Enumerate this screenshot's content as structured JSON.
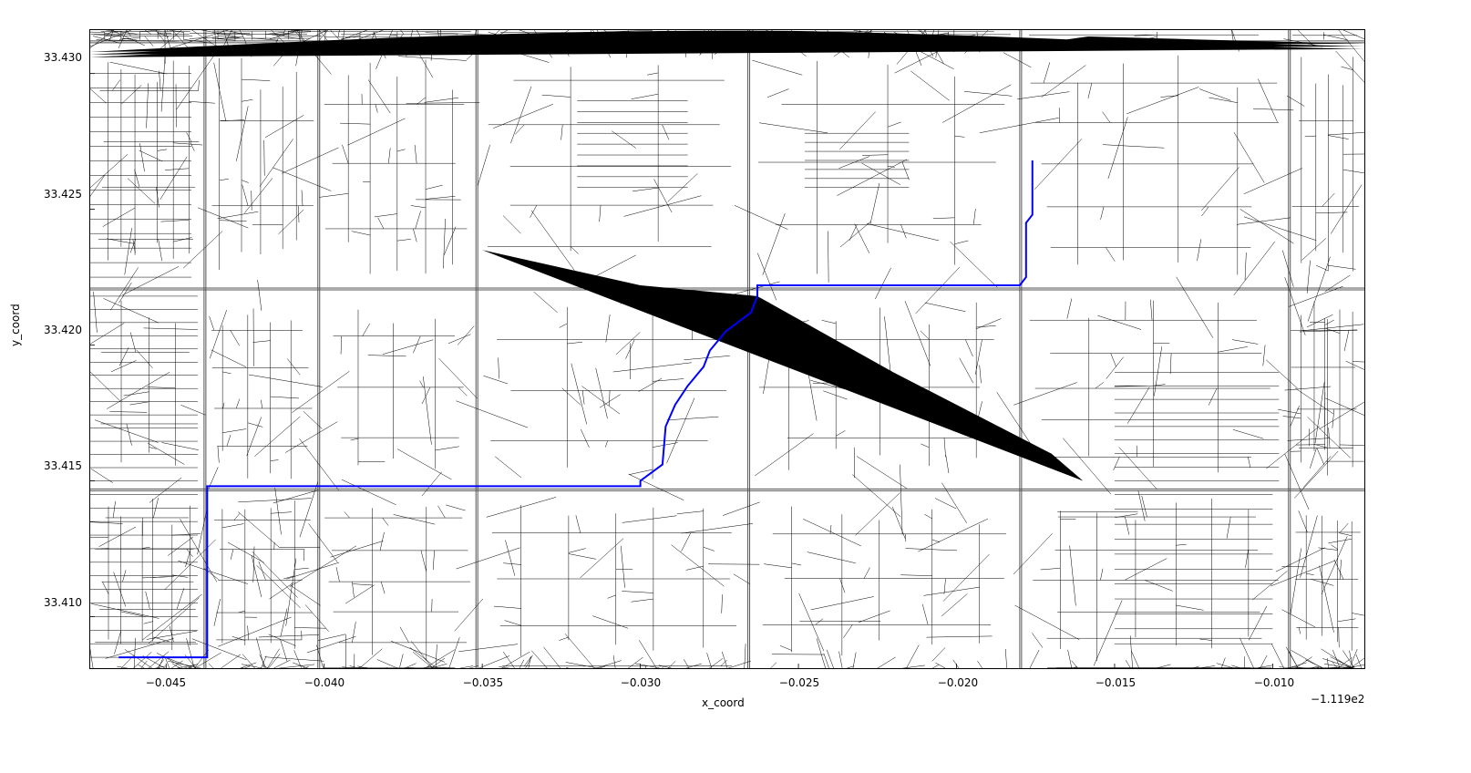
{
  "axes": {
    "xlabel": "x_coord",
    "ylabel": "y_coord",
    "x_offset_text": "−1.119e2",
    "x_ticks": [
      "−0.045",
      "−0.040",
      "−0.035",
      "−0.030",
      "−0.025",
      "−0.020",
      "−0.015",
      "−0.010"
    ],
    "y_ticks": [
      "33.410",
      "33.415",
      "33.420",
      "33.425",
      "33.430"
    ],
    "x_range": [
      -0.0474,
      -0.0071
    ],
    "y_range": [
      33.4081,
      33.4316
    ]
  },
  "chart_data": {
    "type": "map",
    "description": "Street network map rendered from coordinates with a highlighted route",
    "crs_hint": "longitude offset by -111.9 (−1.119e2), latitude",
    "route": {
      "color": "#0000ff",
      "points": [
        [
          -0.0465,
          33.4085
        ],
        [
          -0.0437,
          33.4085
        ],
        [
          -0.0437,
          33.4148
        ],
        [
          -0.03,
          33.4148
        ],
        [
          -0.03,
          33.415
        ],
        [
          -0.0293,
          33.4156
        ],
        [
          -0.0292,
          33.417
        ],
        [
          -0.0289,
          33.4178
        ],
        [
          -0.0285,
          33.4185
        ],
        [
          -0.028,
          33.4192
        ],
        [
          -0.0278,
          33.4198
        ],
        [
          -0.0273,
          33.4205
        ],
        [
          -0.0265,
          33.4212
        ],
        [
          -0.0263,
          33.4218
        ],
        [
          -0.0263,
          33.4222
        ],
        [
          -0.018,
          33.4222
        ],
        [
          -0.0178,
          33.4225
        ],
        [
          -0.0178,
          33.4245
        ],
        [
          -0.0176,
          33.4248
        ],
        [
          -0.0176,
          33.4268
        ]
      ]
    },
    "major_roads_horizontal_y": [
      33.408,
      33.4147,
      33.4221,
      33.4312
    ],
    "major_roads_vertical_x": [
      -0.0438,
      -0.0402,
      -0.0352,
      -0.0266,
      -0.018,
      -0.0095
    ],
    "network_density": "dense urban street grid with irregular local streets and diagonals"
  }
}
